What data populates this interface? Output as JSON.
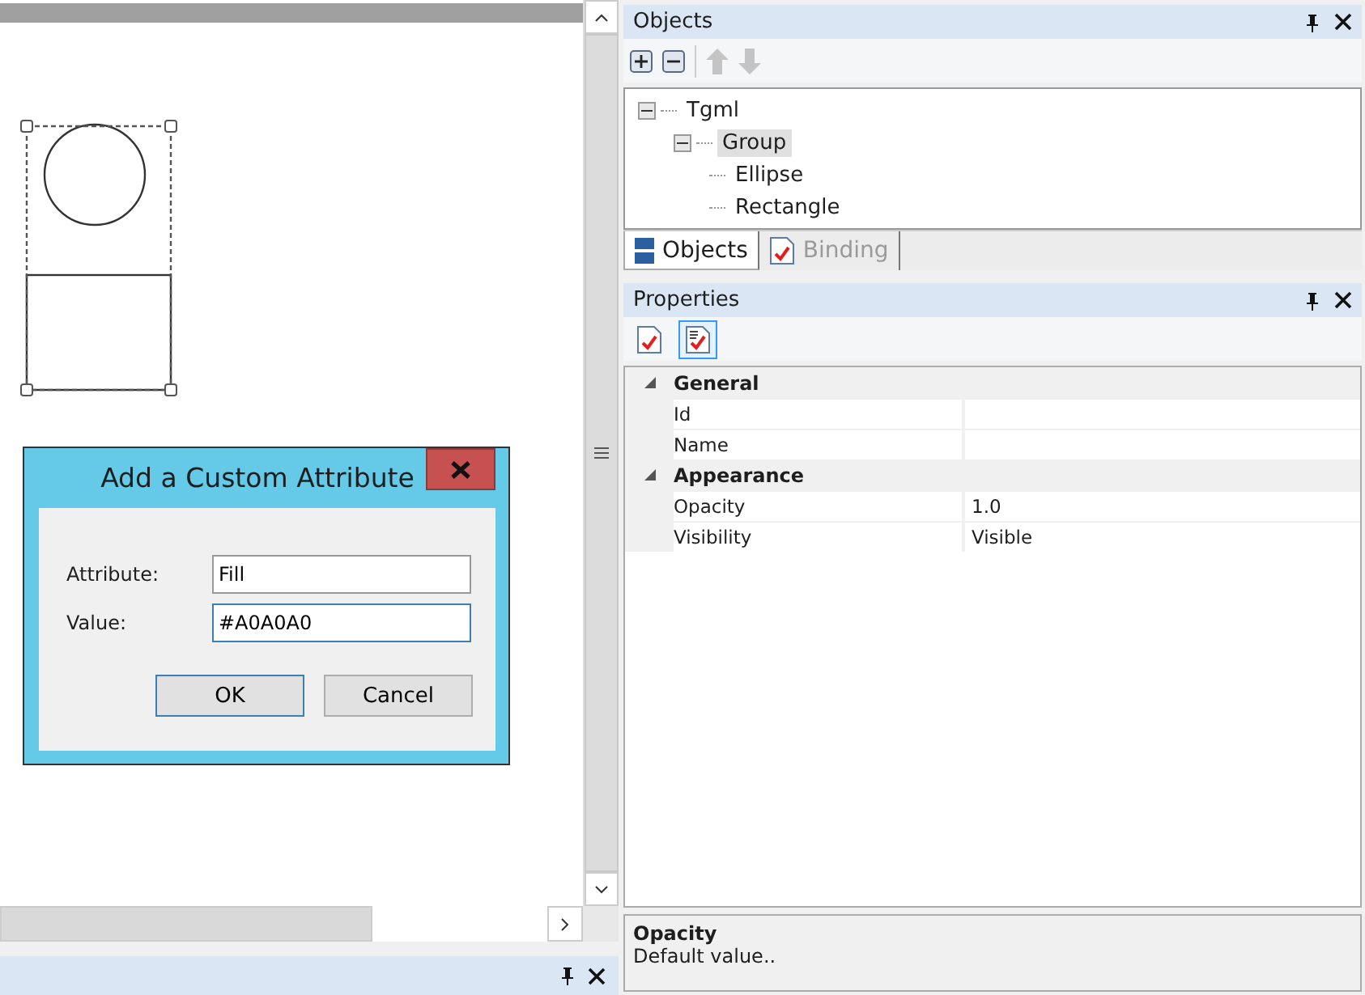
{
  "canvas": {
    "selection": true,
    "shapes": [
      {
        "kind": "ellipse"
      },
      {
        "kind": "rectangle"
      }
    ]
  },
  "dialog": {
    "title": "Add a Custom Attribute",
    "fields": [
      {
        "label": "Attribute:",
        "value": "Fill",
        "focused": false
      },
      {
        "label": "Value:",
        "value": "#A0A0A0",
        "focused": true
      }
    ],
    "buttons": [
      {
        "label": "OK",
        "default": true
      },
      {
        "label": "Cancel",
        "default": false
      }
    ]
  },
  "objects_panel": {
    "title": "Objects",
    "tree": [
      {
        "label": "Tgml",
        "expanded": true,
        "selected": false,
        "children": [
          {
            "label": "Group",
            "expanded": true,
            "selected": true,
            "children": [
              {
                "label": "Ellipse",
                "selected": false
              },
              {
                "label": "Rectangle",
                "selected": false
              }
            ]
          }
        ]
      }
    ],
    "tabs": [
      {
        "label": "Objects",
        "kind": "objects",
        "selected": true
      },
      {
        "label": "Binding",
        "kind": "binding",
        "selected": false
      }
    ]
  },
  "properties_panel": {
    "title": "Properties",
    "views": [
      {
        "kind": "alphabetical",
        "selected": false
      },
      {
        "kind": "categorized",
        "selected": true
      }
    ],
    "categories": [
      {
        "name": "General",
        "expanded": true,
        "properties": [
          {
            "name": "Id"
          },
          {
            "name": "Name"
          }
        ]
      },
      {
        "name": "Appearance",
        "expanded": true,
        "properties": [
          {
            "name": "Opacity",
            "value": "1.0"
          },
          {
            "name": "Visibility",
            "value": "Visible"
          }
        ]
      }
    ],
    "description": {
      "title": "Opacity",
      "text": "Default value.."
    }
  }
}
